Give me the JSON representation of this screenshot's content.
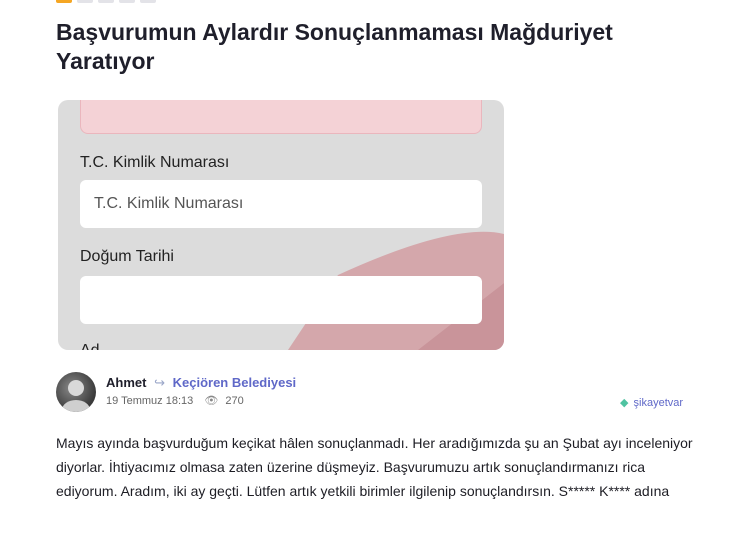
{
  "rating": {
    "filled": 1,
    "total": 5
  },
  "title": "Başvurumun Aylardır Sonuçlanmaması Mağduriyet Yaratıyor",
  "screenshot": {
    "field1_label": "T.C. Kimlik Numarası",
    "field1_placeholder": "T.C. Kimlik Numarası",
    "field2_label": "Doğum Tarihi",
    "field2_value": "",
    "cut_label": "Ad"
  },
  "author": {
    "name": "Ahmet",
    "company": "Keçiören Belediyesi",
    "date": "19 Temmuz 18:13",
    "views": "270",
    "eye_icon": "eye-icon",
    "arrow_icon": "share-arrow-icon"
  },
  "brand": {
    "name": "şikayetvar",
    "color": "#5f68c8"
  },
  "complaint_text": "Mayıs ayında başvurduğum keçikat hâlen sonuçlanmadı. Her aradığımızda şu an Şubat ayı inceleniyor diyorlar. İhtiyacımız olmasa zaten üzerine düşmeyiz. Başvurumuzu artık sonuçlandırmanızı rica ediyorum. Aradım, iki ay geçti. Lütfen artık yetkili birimler ilgilenip sonuçlandırsın. S***** K**** adına",
  "colors": {
    "accent": "#f5a623",
    "link": "#5f68c8"
  }
}
